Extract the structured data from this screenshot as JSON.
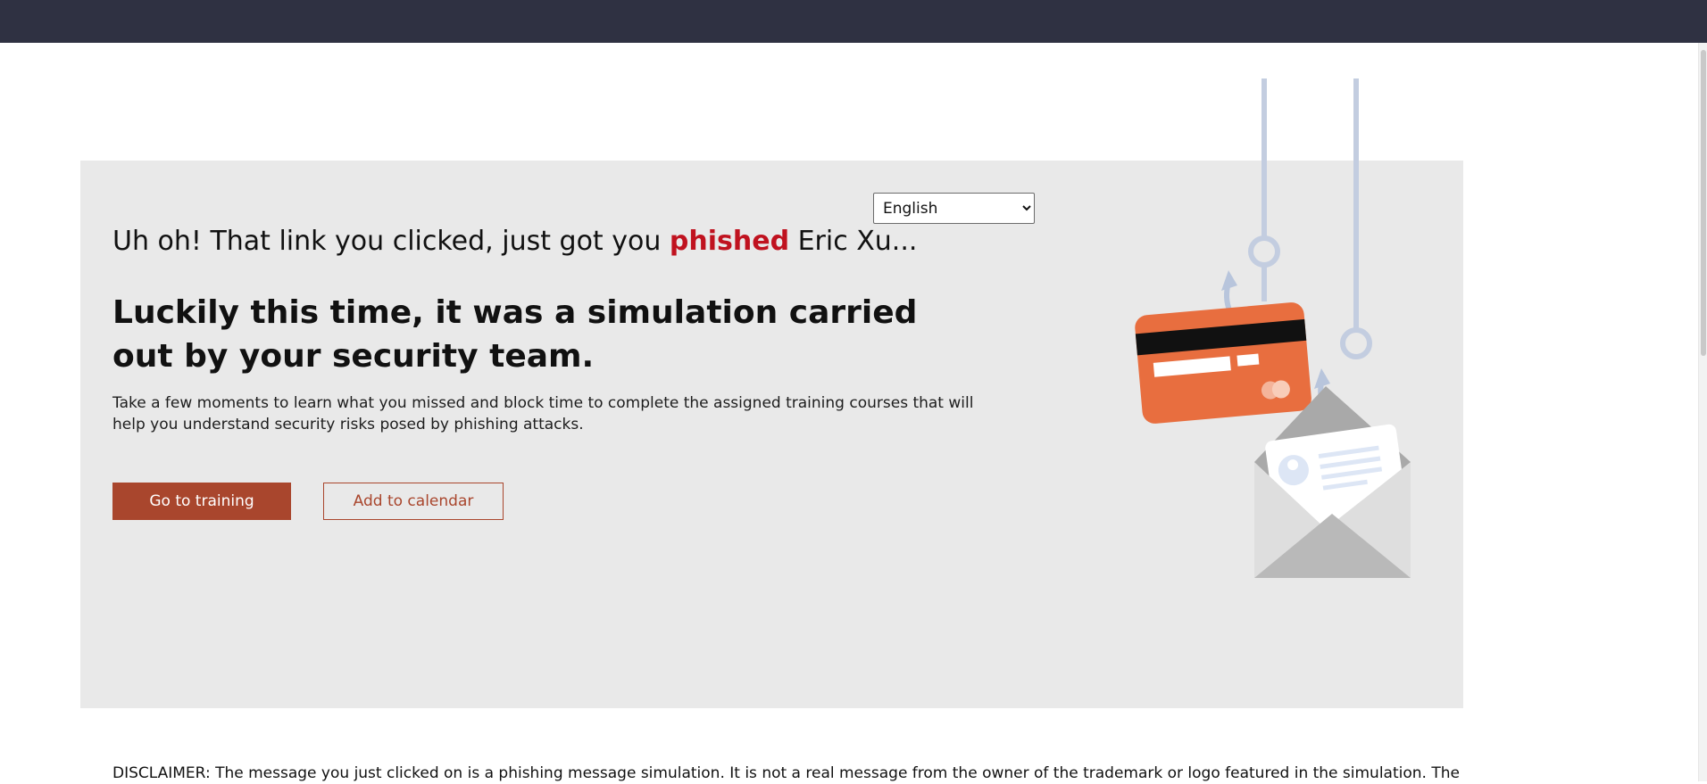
{
  "language_select": {
    "selected": "English",
    "options": [
      "English"
    ]
  },
  "headline": {
    "before": "Uh oh! That link you clicked, just got you ",
    "emphasis": "phished",
    "after": " Eric Xu..."
  },
  "subheadline": "Luckily this time, it was a simulation carried out by your security team.",
  "description": "Take a few moments to learn what you missed and block time to complete the assigned training courses that will help you understand security risks posed by phishing attacks.",
  "buttons": {
    "training": "Go to training",
    "calendar": "Add to calendar"
  },
  "disclaimer": "DISCLAIMER: The message you just clicked on is a phishing message simulation. It is not a real message from the owner of the trademark or logo featured in the simulation. The",
  "illustration": {
    "icons": [
      "fishing-hook-icon",
      "credit-card-icon",
      "envelope-icon"
    ]
  },
  "colors": {
    "top_bar": "#2f3142",
    "hero_background": "#e9e9e9",
    "accent": "#a9462d",
    "phished_text": "#c0121f",
    "card": "#e86e3f",
    "hook_line": "#c3cde0"
  }
}
